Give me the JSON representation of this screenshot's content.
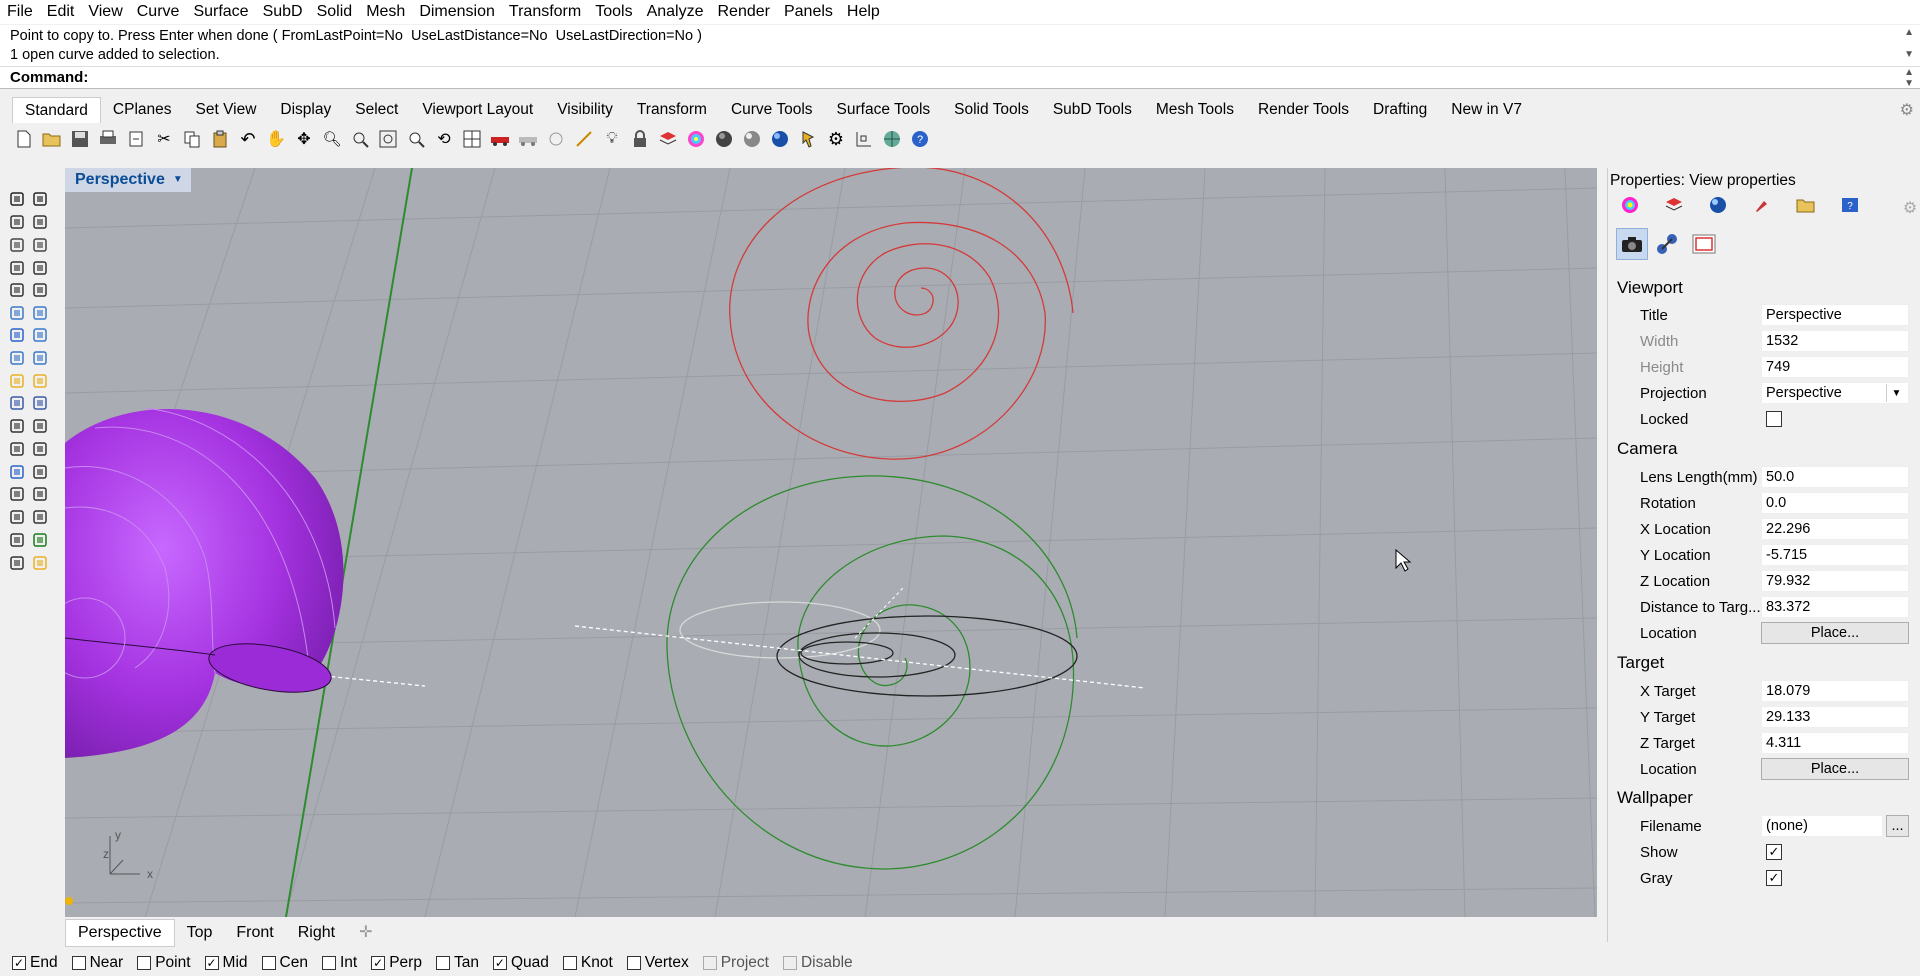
{
  "menu": [
    "File",
    "Edit",
    "View",
    "Curve",
    "Surface",
    "SubD",
    "Solid",
    "Mesh",
    "Dimension",
    "Transform",
    "Tools",
    "Analyze",
    "Render",
    "Panels",
    "Help"
  ],
  "command_history": {
    "line1": "Point to copy to. Press Enter when done ( FromLastPoint=No  UseLastDistance=No  UseLastDirection=No )",
    "line2": "1 open curve added to selection."
  },
  "command_prompt": "Command:",
  "toolbar_tabs": [
    "Standard",
    "CPlanes",
    "Set View",
    "Display",
    "Select",
    "Viewport Layout",
    "Visibility",
    "Transform",
    "Curve Tools",
    "Surface Tools",
    "Solid Tools",
    "SubD Tools",
    "Mesh Tools",
    "Render Tools",
    "Drafting",
    "New in V7"
  ],
  "active_toolbar_tab": "Standard",
  "viewport": {
    "title": "Perspective",
    "axis_x": "x",
    "axis_y": "y",
    "axis_z": "z"
  },
  "viewport_tabs": [
    "Perspective",
    "Top",
    "Front",
    "Right"
  ],
  "active_viewport_tab": "Perspective",
  "osnaps": [
    {
      "label": "End",
      "checked": true,
      "disabled": false
    },
    {
      "label": "Near",
      "checked": false,
      "disabled": false
    },
    {
      "label": "Point",
      "checked": false,
      "disabled": false
    },
    {
      "label": "Mid",
      "checked": true,
      "disabled": false
    },
    {
      "label": "Cen",
      "checked": false,
      "disabled": false
    },
    {
      "label": "Int",
      "checked": false,
      "disabled": false
    },
    {
      "label": "Perp",
      "checked": true,
      "disabled": false
    },
    {
      "label": "Tan",
      "checked": false,
      "disabled": false
    },
    {
      "label": "Quad",
      "checked": true,
      "disabled": false
    },
    {
      "label": "Knot",
      "checked": false,
      "disabled": false
    },
    {
      "label": "Vertex",
      "checked": false,
      "disabled": false
    },
    {
      "label": "Project",
      "checked": false,
      "disabled": true
    },
    {
      "label": "Disable",
      "checked": false,
      "disabled": true
    }
  ],
  "properties": {
    "title": "Properties: View properties",
    "viewport_section": "Viewport",
    "title_label": "Title",
    "title_value": "Perspective",
    "width_label": "Width",
    "width_value": "1532",
    "height_label": "Height",
    "height_value": "749",
    "projection_label": "Projection",
    "projection_value": "Perspective",
    "locked_label": "Locked",
    "locked": false,
    "camera_section": "Camera",
    "lens_label": "Lens Length(mm)",
    "lens_value": "50.0",
    "rotation_label": "Rotation",
    "rotation_value": "0.0",
    "xloc_label": "X Location",
    "xloc_value": "22.296",
    "yloc_label": "Y Location",
    "yloc_value": "-5.715",
    "zloc_label": "Z Location",
    "zloc_value": "79.932",
    "dist_label": "Distance to Targ...",
    "dist_value": "83.372",
    "cam_location_label": "Location",
    "cam_place": "Place...",
    "target_section": "Target",
    "xt_label": "X Target",
    "xt_value": "18.079",
    "yt_label": "Y Target",
    "yt_value": "29.133",
    "zt_label": "Z Target",
    "zt_value": "4.311",
    "tgt_location_label": "Location",
    "tgt_place": "Place...",
    "wallpaper_section": "Wallpaper",
    "filename_label": "Filename",
    "filename_value": "(none)",
    "browse": "...",
    "show_label": "Show",
    "show": true,
    "gray_label": "Gray",
    "gray": true
  },
  "colors": {
    "viewport_bg": "#a9adb3",
    "shell": "#a432e0",
    "red_spiral": "#d43a3a",
    "green_spiral": "#2e8b2e",
    "title_blue": "#0b4c96"
  }
}
